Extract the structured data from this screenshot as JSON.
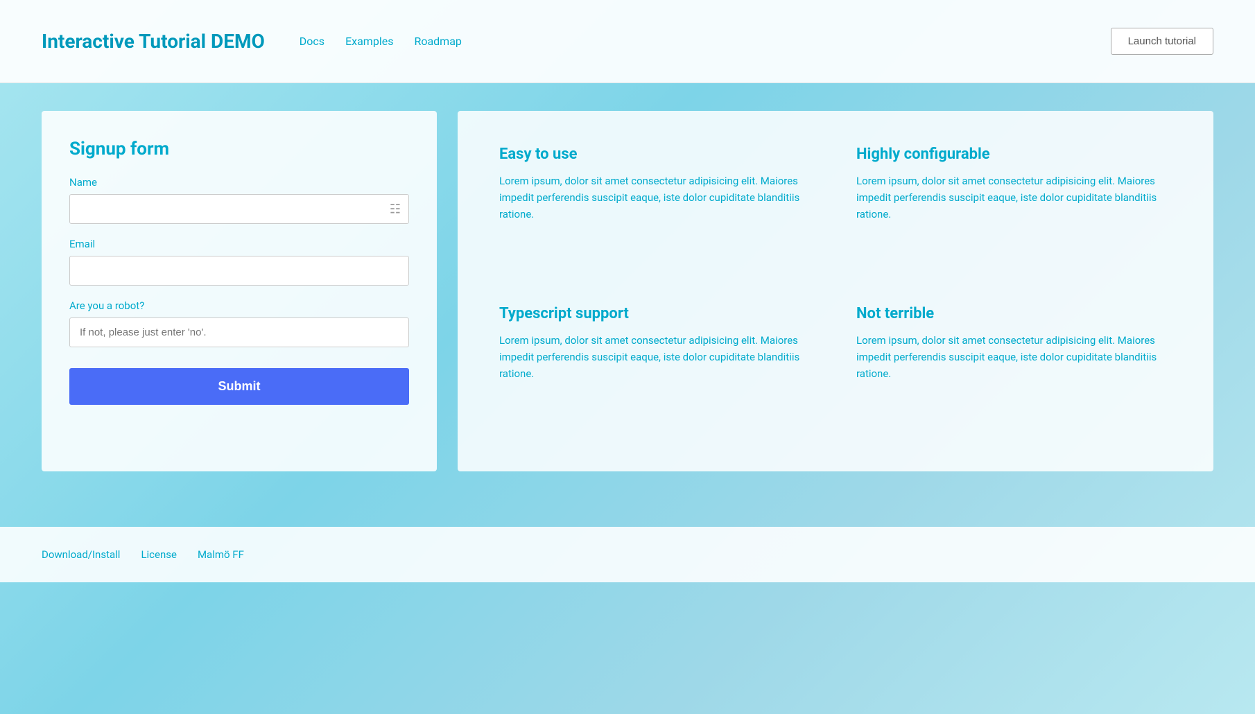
{
  "header": {
    "title": "Interactive Tutorial DEMO",
    "nav": [
      {
        "label": "Docs"
      },
      {
        "label": "Examples"
      },
      {
        "label": "Roadmap"
      }
    ],
    "launch_button": "Launch tutorial"
  },
  "signup_form": {
    "title": "Signup form",
    "name_label": "Name",
    "name_placeholder": "",
    "email_label": "Email",
    "email_placeholder": "",
    "robot_label": "Are you a robot?",
    "robot_placeholder": "If not, please just enter 'no'.",
    "submit_label": "Submit"
  },
  "features": [
    {
      "title": "Easy to use",
      "description": "Lorem ipsum, dolor sit amet consectetur adipisicing elit. Maiores impedit perferendis suscipit eaque, iste dolor cupiditate blanditiis ratione."
    },
    {
      "title": "Highly configurable",
      "description": "Lorem ipsum, dolor sit amet consectetur adipisicing elit. Maiores impedit perferendis suscipit eaque, iste dolor cupiditate blanditiis ratione."
    },
    {
      "title": "Typescript support",
      "description": "Lorem ipsum, dolor sit amet consectetur adipisicing elit. Maiores impedit perferendis suscipit eaque, iste dolor cupiditate blanditiis ratione."
    },
    {
      "title": "Not terrible",
      "description": "Lorem ipsum, dolor sit amet consectetur adipisicing elit. Maiores impedit perferendis suscipit eaque, iste dolor cupiditate blanditiis ratione."
    }
  ],
  "footer": {
    "links": [
      {
        "label": "Download/Install"
      },
      {
        "label": "License"
      },
      {
        "label": "Malmö FF"
      }
    ]
  }
}
